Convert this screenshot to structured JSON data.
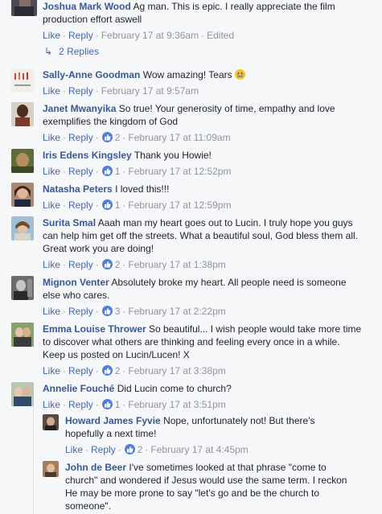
{
  "actions": {
    "like": "Like",
    "reply": "Reply",
    "sep": "·"
  },
  "comments": [
    {
      "name": "Joshua Mark Wood",
      "text": "Ag man. This is epic. I really appreciate the film production effort aswell",
      "time": "February 17 at 9:36am",
      "edited": "Edited",
      "replies_label": "2 Replies"
    },
    {
      "name": "Sally-Anne Goodman",
      "text": "Wow amazing! Tears",
      "time": "February 17 at 9:57am"
    },
    {
      "name": "Janet Mwanyika",
      "text": "So true! Your generosity of time, empathy and love exemplifies the kingdom of God",
      "likes": "2",
      "time": "February 17 at 11:09am"
    },
    {
      "name": "Iris Edens Kingsley",
      "text": "Thank you Howie!",
      "likes": "1",
      "time": "February 17 at 12:52pm"
    },
    {
      "name": "Natasha Peters",
      "text": "I loved this!!!",
      "likes": "1",
      "time": "February 17 at 12:59pm"
    },
    {
      "name": "Surita Smal",
      "text": "Aaah man my heart goes out to Lucin. I truly hope you guys can help him get off the streets. What a beautiful soul, God bless them all. Great work you are doing!",
      "likes": "2",
      "time": "February 17 at 1:38pm"
    },
    {
      "name": "Mignon Venter",
      "text": "Absolutely broke my heart. All people need is someone else who cares.",
      "likes": "3",
      "time": "February 17 at 2:22pm"
    },
    {
      "name": "Emma Louise Thrower",
      "text": "So beautiful... I wish people would take more time to discover what others are thinking and feeling every once in a while. Keep us posted on Lucin/Lucen! X",
      "likes": "2",
      "time": "February 17 at 3:38pm"
    },
    {
      "name": "Annelie Fouché",
      "text": "Did Lucin come to church?",
      "likes": "1",
      "time": "February 17 at 3:51pm"
    },
    {
      "name": "Howard James Fyvie",
      "text": "Nope, unfortunately not! But there's hopefully a next time!",
      "likes": "2",
      "time": "February 17 at 4:45pm"
    },
    {
      "name": "John de Beer",
      "text": "I've sometimes looked at that phrase \"come to church\" and wondered if Jesus would use the same term. I reckon He may be more prone to say \"let's go and be the church to someone\"."
    }
  ],
  "colors": {
    "link": "#4267b2",
    "name": "#365899",
    "meta": "#90949c",
    "like_badge": "#4f7fd9",
    "background": "#f6f7f9"
  }
}
